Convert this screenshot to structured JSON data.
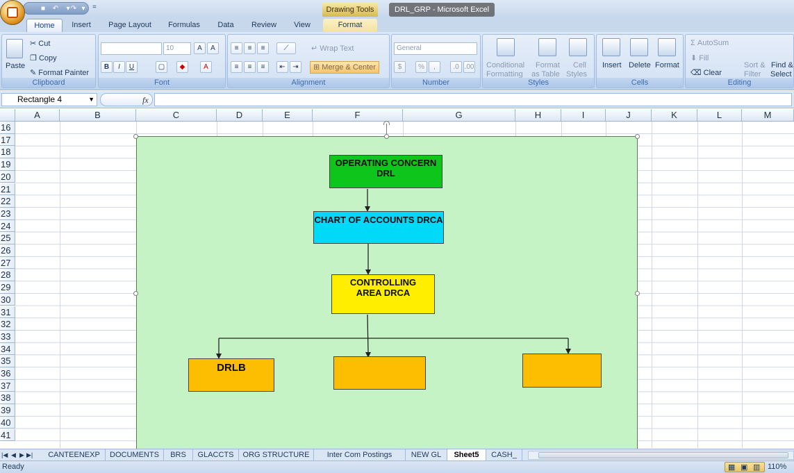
{
  "app": {
    "context_tab_title": "Drawing Tools",
    "window_title": "DRL_GRP - Microsoft Excel"
  },
  "tabs": [
    {
      "label": "Home",
      "active": true
    },
    {
      "label": "Insert"
    },
    {
      "label": "Page Layout"
    },
    {
      "label": "Formulas"
    },
    {
      "label": "Data"
    },
    {
      "label": "Review"
    },
    {
      "label": "View"
    },
    {
      "label": "Format",
      "contextual": true
    }
  ],
  "ribbon": {
    "clipboard": {
      "paste": "Paste",
      "cut": "Cut",
      "copy": "Copy",
      "format_painter": "Format Painter",
      "label": "Clipboard"
    },
    "font": {
      "name": "",
      "size": "10",
      "bold": "B",
      "italic": "I",
      "underline": "U",
      "label": "Font"
    },
    "alignment": {
      "wrap_text": "Wrap Text",
      "merge_center": "Merge & Center",
      "label": "Alignment"
    },
    "number": {
      "format": "General",
      "currency": "$",
      "percent": "%",
      "comma": ",",
      "label": "Number"
    },
    "styles": {
      "conditional": "Conditional",
      "conditional2": "Formatting",
      "format_table": "Format",
      "format_table2": "as Table",
      "cell_styles": "Cell",
      "cell_styles2": "Styles",
      "label": "Styles"
    },
    "cells": {
      "insert": "Insert",
      "delete": "Delete",
      "format": "Format",
      "label": "Cells"
    },
    "editing": {
      "autosum": "AutoSum",
      "fill": "Fill",
      "clear": "Clear",
      "sort_filter": "Sort &",
      "sort_filter2": "Filter",
      "find_select": "Find &",
      "find_select2": "Select",
      "label": "Editing"
    }
  },
  "formula_bar": {
    "name_box": "Rectangle 4",
    "fx": "fx",
    "value": ""
  },
  "columns": [
    "A",
    "B",
    "C",
    "D",
    "E",
    "F",
    "G",
    "H",
    "I",
    "J",
    "K",
    "L",
    "M"
  ],
  "rows": [
    "16",
    "17",
    "18",
    "19",
    "20",
    "21",
    "22",
    "23",
    "24",
    "25",
    "26",
    "27",
    "28",
    "29",
    "30",
    "31",
    "32",
    "33",
    "34",
    "35",
    "36",
    "37",
    "38",
    "39",
    "40",
    "41"
  ],
  "diagram": {
    "operating_concern": "OPERATING CONCERN DRL",
    "chart_of_accounts": "CHART OF ACCOUNTS DRCA",
    "controlling_area": "CONTROLLING AREA DRCA",
    "company_1": "DRLB",
    "company_2": "",
    "company_3": "",
    "colors": {
      "background": "#c6f3c6",
      "operating_concern": "#0ec51b",
      "chart_of_accounts": "#00d9f7",
      "controlling_area": "#ffee00",
      "company": "#fdbd00"
    }
  },
  "sheet_tabs": [
    {
      "label": "CANTEENEXP"
    },
    {
      "label": "DOCUMENTS"
    },
    {
      "label": "BRS"
    },
    {
      "label": "GLACCTS"
    },
    {
      "label": "ORG STRUCTURE"
    },
    {
      "label": "Inter Com Postings"
    },
    {
      "label": "NEW GL"
    },
    {
      "label": "Sheet5",
      "active": true
    },
    {
      "label": "CASH_"
    }
  ],
  "status": {
    "ready": "Ready",
    "zoom": "110%"
  }
}
